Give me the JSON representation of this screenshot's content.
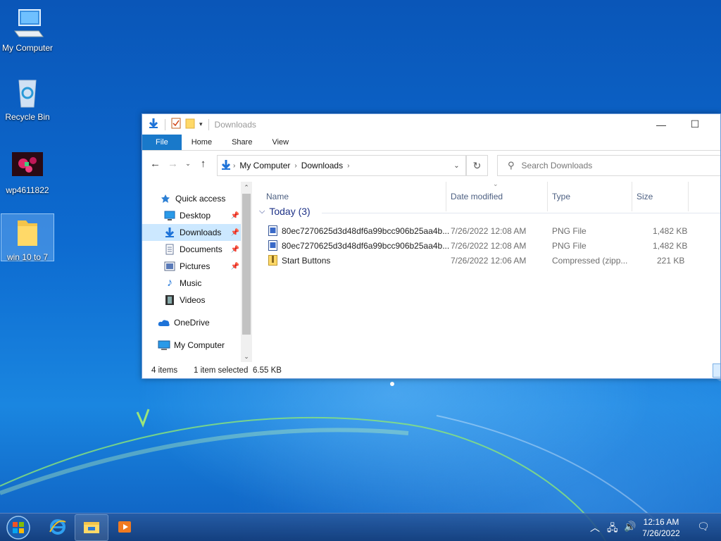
{
  "desktop": {
    "icons": [
      {
        "label": "My Computer"
      },
      {
        "label": "Recycle Bin"
      },
      {
        "label": "wp4611822"
      },
      {
        "label": "win 10 to 7"
      }
    ]
  },
  "window": {
    "title": "Downloads",
    "controls": {
      "minimize": "—",
      "maximize": "☐"
    },
    "ribbon_tabs": [
      "File",
      "Home",
      "Share",
      "View"
    ],
    "address": {
      "crumbs": [
        "My Computer",
        "Downloads"
      ]
    },
    "search": {
      "placeholder": "Search Downloads"
    },
    "nav_pane": [
      {
        "label": "Quick access",
        "icon": "star-icon"
      },
      {
        "label": "Desktop",
        "icon": "desktop-icon",
        "pinned": true
      },
      {
        "label": "Downloads",
        "icon": "download-arrow-icon",
        "pinned": true,
        "selected": true
      },
      {
        "label": "Documents",
        "icon": "document-icon",
        "pinned": true
      },
      {
        "label": "Pictures",
        "icon": "pictures-icon",
        "pinned": true
      },
      {
        "label": "Music",
        "icon": "music-note-icon"
      },
      {
        "label": "Videos",
        "icon": "film-icon"
      },
      {
        "label": "OneDrive",
        "icon": "cloud-icon"
      },
      {
        "label": "My Computer",
        "icon": "computer-icon"
      }
    ],
    "columns": [
      "Name",
      "Date modified",
      "Type",
      "Size"
    ],
    "group": {
      "label": "Today (3)"
    },
    "files": [
      {
        "name": "80ec7270625d3d48df6a99bcc906b25aa4b...",
        "date": "7/26/2022 12:08 AM",
        "type": "PNG File",
        "size": "1,482 KB",
        "icon": "image-file-icon"
      },
      {
        "name": "80ec7270625d3d48df6a99bcc906b25aa4b...",
        "date": "7/26/2022 12:08 AM",
        "type": "PNG File",
        "size": "1,482 KB",
        "icon": "image-file-icon"
      },
      {
        "name": "Start Buttons",
        "date": "7/26/2022 12:06 AM",
        "type": "Compressed (zipp...",
        "size": "221 KB",
        "icon": "zip-folder-icon"
      }
    ],
    "status": {
      "items": "4 items",
      "selected": "1 item selected",
      "size": "6.55 KB"
    }
  },
  "taskbar": {
    "apps": [
      "internet-explorer-icon",
      "file-explorer-icon",
      "media-player-icon"
    ],
    "clock": {
      "time": "12:16 AM",
      "date": "7/26/2022"
    }
  }
}
